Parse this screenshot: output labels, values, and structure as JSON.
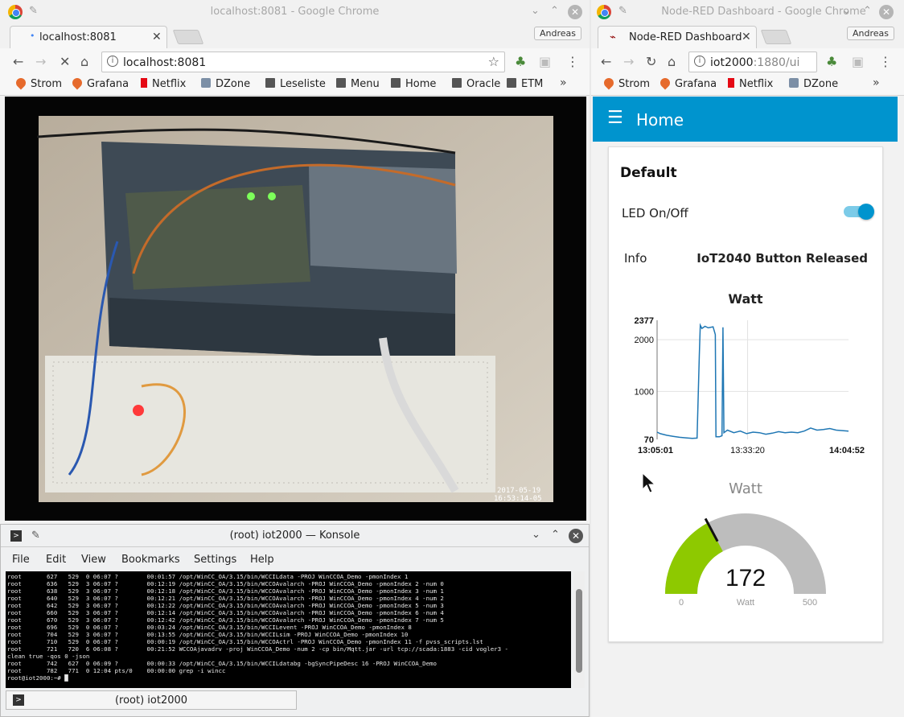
{
  "left_browser": {
    "window_title": "localhost:8081 - Google Chrome",
    "tab_label": "localhost:8081",
    "profile": "Andreas",
    "url": "localhost:8081",
    "bookmarks": [
      {
        "label": "Strom",
        "icon": "flame"
      },
      {
        "label": "Grafana",
        "icon": "flame"
      },
      {
        "label": "Netflix",
        "icon": "net"
      },
      {
        "label": "DZone",
        "icon": "dz"
      },
      {
        "label": "Leseliste",
        "icon": "folder"
      },
      {
        "label": "Menu",
        "icon": "folder"
      },
      {
        "label": "Home",
        "icon": "folder"
      },
      {
        "label": "Oracle",
        "icon": "folder"
      },
      {
        "label": "ETM",
        "icon": "folder"
      }
    ],
    "webcam_timestamp_date": "2017-05-19",
    "webcam_timestamp_time": "16:53:14-05"
  },
  "right_browser": {
    "window_title": "Node-RED Dashboard - Google Chrome",
    "tab_label": "Node-RED Dashboard",
    "profile": "Andreas",
    "url_host": "iot2000",
    "url_rest": ":1880/ui",
    "bookmarks": [
      {
        "label": "Strom",
        "icon": "flame"
      },
      {
        "label": "Grafana",
        "icon": "flame"
      },
      {
        "label": "Netflix",
        "icon": "net"
      },
      {
        "label": "DZone",
        "icon": "dz"
      }
    ]
  },
  "dashboard": {
    "header_title": "Home",
    "group_title": "Default",
    "switch_label": "LED On/Off",
    "switch_on": true,
    "info_label": "Info",
    "info_value": "IoT2040 Button Released",
    "accent": "#0094ce",
    "chart_title": "Watt",
    "gauge_title": "Watt",
    "gauge_value": "172",
    "gauge_units": "Watt",
    "gauge_min": "0",
    "gauge_max": "500",
    "gauge_fraction": 0.344
  },
  "chart_data": {
    "type": "line",
    "title": "Watt",
    "x_ticks": [
      "13:05:01",
      "13:33:20",
      "14:04:52"
    ],
    "y_ticks": [
      "2377",
      "2000",
      "1000",
      "70"
    ],
    "ylim": [
      70,
      2377
    ],
    "series": [
      {
        "color": "#1f77b4",
        "points": [
          [
            0,
            210
          ],
          [
            1,
            180
          ],
          [
            3,
            150
          ],
          [
            5,
            130
          ],
          [
            7,
            110
          ],
          [
            9,
            100
          ],
          [
            11,
            90
          ],
          [
            12.5,
            95
          ],
          [
            13.2,
            1700
          ],
          [
            13.5,
            2280
          ],
          [
            14.0,
            2220
          ],
          [
            15.0,
            2260
          ],
          [
            16.0,
            2230
          ],
          [
            17.5,
            2250
          ],
          [
            18.2,
            2100
          ],
          [
            18.4,
            120
          ],
          [
            19.5,
            120
          ],
          [
            20.3,
            140
          ],
          [
            20.6,
            2240
          ],
          [
            20.9,
            200
          ],
          [
            22,
            250
          ],
          [
            24,
            200
          ],
          [
            26,
            230
          ],
          [
            28,
            180
          ],
          [
            30,
            210
          ],
          [
            32,
            200
          ],
          [
            34,
            170
          ],
          [
            36,
            190
          ],
          [
            38,
            220
          ],
          [
            40,
            200
          ],
          [
            42,
            210
          ],
          [
            44,
            200
          ],
          [
            46,
            230
          ],
          [
            48,
            290
          ],
          [
            50,
            250
          ],
          [
            52,
            260
          ],
          [
            54,
            280
          ],
          [
            56,
            250
          ],
          [
            59.85,
            230
          ]
        ]
      }
    ],
    "x_domain_minutes": [
      0,
      59.85
    ],
    "grid": true
  },
  "konsole": {
    "title": "(root) iot2000 — Konsole",
    "menu": [
      "File",
      "Edit",
      "View",
      "Bookmarks",
      "Settings",
      "Help"
    ],
    "tab_label": "(root) iot2000",
    "lines": [
      "root       627   529  0 06:07 ?        00:01:57 /opt/WinCC_OA/3.15/bin/WCCILdata -PROJ WinCCOA_Demo -pmonIndex 1",
      "root       636   529  3 06:07 ?        00:12:19 /opt/WinCC_OA/3.15/bin/WCCOAvalarch -PROJ WinCCOA_Demo -pmonIndex 2 -num 0",
      "root       638   529  3 06:07 ?        00:12:18 /opt/WinCC_OA/3.15/bin/WCCOAvalarch -PROJ WinCCOA_Demo -pmonIndex 3 -num 1",
      "root       640   529  3 06:07 ?        00:12:21 /opt/WinCC_OA/3.15/bin/WCCOAvalarch -PROJ WinCCOA_Demo -pmonIndex 4 -num 2",
      "root       642   529  3 06:07 ?        00:12:22 /opt/WinCC_OA/3.15/bin/WCCOAvalarch -PROJ WinCCOA_Demo -pmonIndex 5 -num 3",
      "root       660   529  3 06:07 ?        00:12:14 /opt/WinCC_OA/3.15/bin/WCCOAvalarch -PROJ WinCCOA_Demo -pmonIndex 6 -num 4",
      "root       670   529  3 06:07 ?        00:12:42 /opt/WinCC_OA/3.15/bin/WCCOAvalarch -PROJ WinCCOA_Demo -pmonIndex 7 -num 5",
      "root       696   529  0 06:07 ?        00:03:24 /opt/WinCC_OA/3.15/bin/WCCILevent -PROJ WinCCOA_Demo -pmonIndex 8",
      "root       704   529  3 06:07 ?        00:13:55 /opt/WinCC_OA/3.15/bin/WCCILsim -PROJ WinCCOA_Demo -pmonIndex 10",
      "root       710   529  0 06:07 ?        00:00:19 /opt/WinCC_OA/3.15/bin/WCCOActrl -PROJ WinCCOA_Demo -pmonIndex 11 -f pvss_scripts.lst",
      "root       721   720  6 06:08 ?        00:21:52 WCCOAjavadrv -proj WinCCOA_Demo -num 2 -cp bin/Mqtt.jar -url tcp://scada:1883 -cid vogler3 -",
      "clean true -qos 0 -json",
      "root       742   627  0 06:09 ?        00:00:33 /opt/WinCC_OA/3.15/bin/WCCILdatabg -bgSyncPipeDesc 16 -PROJ WinCCOA_Demo",
      "root       782   771  0 12:04 pts/0    00:00:00 grep -i wincc",
      "root@iot2000:~# █"
    ]
  }
}
